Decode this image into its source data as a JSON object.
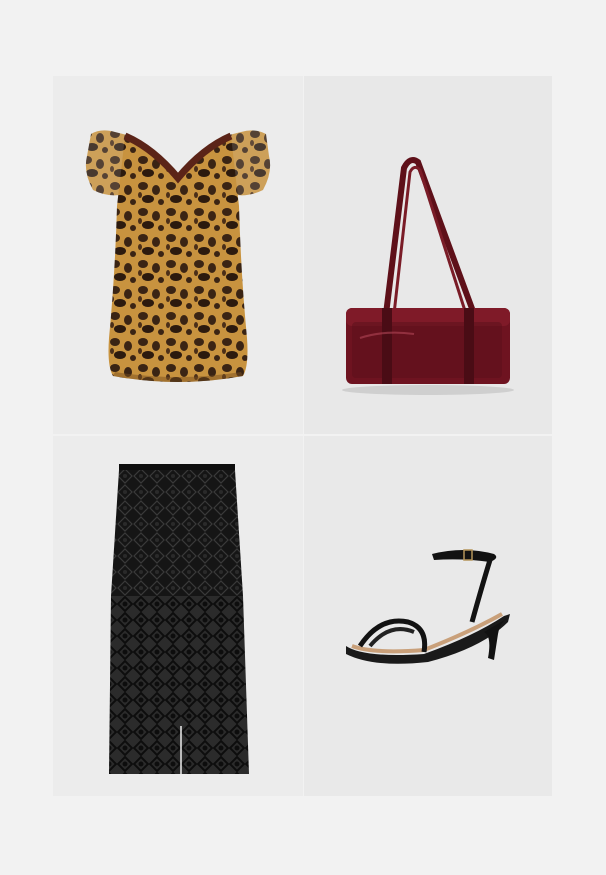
{
  "outfit": {
    "items": [
      {
        "item": "leopard-print-top",
        "colors": [
          "#c8933f",
          "#3a2414",
          "#5b2418"
        ]
      },
      {
        "item": "handbag",
        "colors": [
          "#6e1320",
          "#4a0c15"
        ]
      },
      {
        "item": "lace-skirt",
        "colors": [
          "#111111",
          "#2a2a2a"
        ]
      },
      {
        "item": "sandal",
        "colors": [
          "#121212",
          "#c9a07a"
        ]
      }
    ]
  }
}
